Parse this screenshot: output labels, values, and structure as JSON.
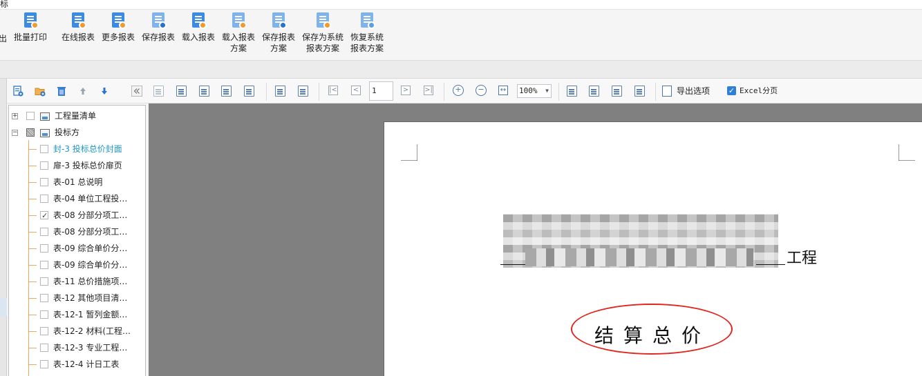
{
  "window": {
    "title": "标"
  },
  "ribbon": {
    "partial_left": "出",
    "buttons": [
      {
        "id": "batch-print",
        "label": "批量打印",
        "icon": "printer-doc-icon"
      },
      {
        "id": "online-report",
        "label": "在线报表",
        "icon": "cloud-doc-icon"
      },
      {
        "id": "more-reports",
        "label": "更多报表",
        "icon": "more-doc-icon"
      },
      {
        "id": "save-report",
        "label": "保存报表",
        "icon": "save-doc-icon"
      },
      {
        "id": "load-report",
        "label": "载入报表",
        "icon": "load-doc-icon"
      },
      {
        "id": "load-scheme",
        "label": "载入报表\n方案",
        "line1": "载入报表",
        "line2": "方案",
        "icon": "load-scheme-icon"
      },
      {
        "id": "save-scheme",
        "label": "保存报表\n方案",
        "line1": "保存报表",
        "line2": "方案",
        "icon": "save-scheme-icon"
      },
      {
        "id": "save-system-scheme",
        "line1": "保存为系统",
        "line2": "报表方案",
        "icon": "save-system-icon"
      },
      {
        "id": "restore-system-scheme",
        "line1": "恢复系统",
        "line2": "报表方案",
        "icon": "restore-system-icon"
      }
    ]
  },
  "left_toolbar": {
    "icons": [
      "add-report-icon",
      "add-folder-icon",
      "delete-icon",
      "move-up-icon",
      "move-down-icon",
      "collapse-panel-icon"
    ]
  },
  "tree": {
    "groups": [
      {
        "label": "工程量清单",
        "expanded": false,
        "checked": "unchecked"
      },
      {
        "label": "投标方",
        "expanded": true,
        "checked": "partial"
      }
    ],
    "items": [
      {
        "label": "封-3 投标总价封面",
        "checked": false,
        "selected": true
      },
      {
        "label": "扉-3 投标总价扉页",
        "checked": false
      },
      {
        "label": "表-01 总说明",
        "checked": false
      },
      {
        "label": "表-04 单位工程投…",
        "checked": false
      },
      {
        "label": "表-08 分部分项工…",
        "checked": true
      },
      {
        "label": "表-08 分部分项工…",
        "checked": false
      },
      {
        "label": "表-09 综合单价分…",
        "checked": false
      },
      {
        "label": "表-09 综合单价分…",
        "checked": false
      },
      {
        "label": "表-11 总价措施项…",
        "checked": false
      },
      {
        "label": "表-12 其他项目清…",
        "checked": false
      },
      {
        "label": "表-12-1 暂列金额…",
        "checked": false
      },
      {
        "label": "表-12-2 材料(工程…",
        "checked": false
      },
      {
        "label": "表-12-3 专业工程…",
        "checked": false
      },
      {
        "label": "表-12-4 计日工表",
        "checked": false
      }
    ]
  },
  "preview_toolbar": {
    "page_number": "1",
    "zoom": "100%",
    "export_options_label": "导出选项",
    "excel_split_label": "Excel分页",
    "excel_split_checked": true
  },
  "document": {
    "project_suffix": "工程",
    "title": "结算总价",
    "annotation_color": "#e0261e"
  },
  "colors": {
    "accent": "#3b8be3",
    "tree_highlight": "#1e96c8",
    "tree_lines": "#f2a65a",
    "preview_bg": "#808080"
  }
}
